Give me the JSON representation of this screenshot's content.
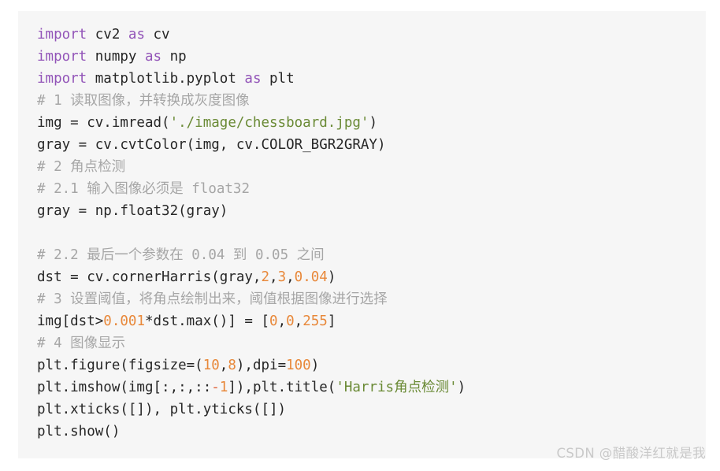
{
  "code_block": {
    "language": "python",
    "background_color": "#f6f6f6",
    "colors": {
      "keyword": "#9254b8",
      "string": "#6a8a35",
      "number": "#e8883a",
      "comment": "#a6a6a6",
      "plain": "#262626",
      "page_background": "#ffffff"
    },
    "lines": [
      {
        "id": "line-1",
        "tokens": [
          {
            "t": "import",
            "c": "kw"
          },
          {
            "t": " cv2 ",
            "c": "pln"
          },
          {
            "t": "as",
            "c": "kw"
          },
          {
            "t": " cv",
            "c": "pln"
          }
        ]
      },
      {
        "id": "line-2",
        "tokens": [
          {
            "t": "import",
            "c": "kw"
          },
          {
            "t": " numpy ",
            "c": "pln"
          },
          {
            "t": "as",
            "c": "kw"
          },
          {
            "t": " np",
            "c": "pln"
          }
        ]
      },
      {
        "id": "line-3",
        "tokens": [
          {
            "t": "import",
            "c": "kw"
          },
          {
            "t": " matplotlib.pyplot ",
            "c": "pln"
          },
          {
            "t": "as",
            "c": "kw"
          },
          {
            "t": " plt",
            "c": "pln"
          }
        ]
      },
      {
        "id": "line-4",
        "tokens": [
          {
            "t": "# 1 读取图像，并转换成灰度图像",
            "c": "com"
          }
        ]
      },
      {
        "id": "line-5",
        "tokens": [
          {
            "t": "img = cv.imread(",
            "c": "pln"
          },
          {
            "t": "'./image/chessboard.jpg'",
            "c": "str"
          },
          {
            "t": ")",
            "c": "pln"
          }
        ]
      },
      {
        "id": "line-6",
        "tokens": [
          {
            "t": "gray = cv.cvtColor(img, cv.COLOR_BGR2GRAY)",
            "c": "pln"
          }
        ]
      },
      {
        "id": "line-7",
        "tokens": [
          {
            "t": "# 2 角点检测",
            "c": "com"
          }
        ]
      },
      {
        "id": "line-8",
        "tokens": [
          {
            "t": "# 2.1 输入图像必须是 float32",
            "c": "com"
          }
        ]
      },
      {
        "id": "line-9",
        "tokens": [
          {
            "t": "gray = np.float32(gray)",
            "c": "pln"
          }
        ]
      },
      {
        "id": "line-10",
        "tokens": []
      },
      {
        "id": "line-11",
        "tokens": [
          {
            "t": "# 2.2 最后一个参数在 0.04 到 0.05 之间",
            "c": "com"
          }
        ]
      },
      {
        "id": "line-12",
        "tokens": [
          {
            "t": "dst = cv.cornerHarris(gray,",
            "c": "pln"
          },
          {
            "t": "2",
            "c": "num"
          },
          {
            "t": ",",
            "c": "pln"
          },
          {
            "t": "3",
            "c": "num"
          },
          {
            "t": ",",
            "c": "pln"
          },
          {
            "t": "0.04",
            "c": "num"
          },
          {
            "t": ")",
            "c": "pln"
          }
        ]
      },
      {
        "id": "line-13",
        "tokens": [
          {
            "t": "# 3 设置阈值，将角点绘制出来，阈值根据图像进行选择",
            "c": "com"
          }
        ]
      },
      {
        "id": "line-14",
        "tokens": [
          {
            "t": "img[dst>",
            "c": "pln"
          },
          {
            "t": "0.001",
            "c": "num"
          },
          {
            "t": "*dst.max()] = [",
            "c": "pln"
          },
          {
            "t": "0",
            "c": "num"
          },
          {
            "t": ",",
            "c": "pln"
          },
          {
            "t": "0",
            "c": "num"
          },
          {
            "t": ",",
            "c": "pln"
          },
          {
            "t": "255",
            "c": "num"
          },
          {
            "t": "]",
            "c": "pln"
          }
        ]
      },
      {
        "id": "line-15",
        "tokens": [
          {
            "t": "# 4 图像显示",
            "c": "com"
          }
        ]
      },
      {
        "id": "line-16",
        "tokens": [
          {
            "t": "plt.figure(figsize=(",
            "c": "pln"
          },
          {
            "t": "10",
            "c": "num"
          },
          {
            "t": ",",
            "c": "pln"
          },
          {
            "t": "8",
            "c": "num"
          },
          {
            "t": "),dpi=",
            "c": "pln"
          },
          {
            "t": "100",
            "c": "num"
          },
          {
            "t": ")",
            "c": "pln"
          }
        ]
      },
      {
        "id": "line-17",
        "tokens": [
          {
            "t": "plt.imshow(img[:,:,::",
            "c": "pln"
          },
          {
            "t": "-",
            "c": "neg"
          },
          {
            "t": "1",
            "c": "num"
          },
          {
            "t": "]),plt.title(",
            "c": "pln"
          },
          {
            "t": "'Harris角点检测'",
            "c": "str"
          },
          {
            "t": ")",
            "c": "pln"
          }
        ]
      },
      {
        "id": "line-18",
        "tokens": [
          {
            "t": "plt.xticks([]), plt.yticks([])",
            "c": "pln"
          }
        ]
      },
      {
        "id": "line-19",
        "tokens": [
          {
            "t": "plt.show()",
            "c": "pln"
          }
        ]
      }
    ]
  },
  "watermark": {
    "text": "CSDN @醋酸洋红就是我",
    "color": "#c9c9c9"
  }
}
